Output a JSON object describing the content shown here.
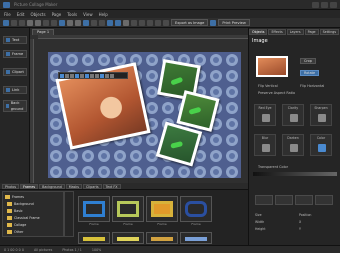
{
  "window": {
    "title": "Picture Collage Maker"
  },
  "menu": [
    "File",
    "Edit",
    "Objects",
    "Page",
    "Tools",
    "View",
    "Help"
  ],
  "toolbar": {
    "export_label": "Export as Image",
    "print_label": "Print Preview"
  },
  "left_panel": {
    "items": [
      "Text",
      "Frame",
      "Clipart",
      "Link",
      "Back ground"
    ]
  },
  "doc_tab": "Page 1",
  "right_panel": {
    "tabs": [
      "Objects",
      "Effects",
      "Layers",
      "Page",
      "Settings"
    ],
    "heading": "Image",
    "buttons": {
      "crop": "Crop",
      "rotate": "Rotate"
    },
    "checks": [
      "Flip Vertical",
      "Flip Horizontal",
      "Preserve Aspect Ratio"
    ],
    "groups": [
      "Red Eye",
      "Clarity",
      "Sharpen",
      "Blur",
      "Darken",
      "Color"
    ],
    "transparency": "Transparent Color"
  },
  "bottom_tabs": [
    "Photos",
    "Frames",
    "Background",
    "Masks",
    "Cliparts",
    "Text FX"
  ],
  "bottom_active": "Frames",
  "tree_items": [
    "Frames",
    "Background",
    "Basic",
    "Classical Frame",
    "Collage",
    "Other"
  ],
  "frame_captions": [
    "Frame",
    "Frame",
    "Frame",
    "Frame"
  ],
  "frame_colors": [
    "#2f7fd1",
    "#b7c85a",
    "#d8b23a",
    "#2a4fa0"
  ],
  "bottom_right": {
    "labels": [
      "Size",
      "Width",
      "Height",
      "Position",
      "X",
      "Y"
    ]
  },
  "status": [
    "0 1 00  0  0 0",
    "All pictures",
    "Photos 1 / 1",
    "100%"
  ]
}
